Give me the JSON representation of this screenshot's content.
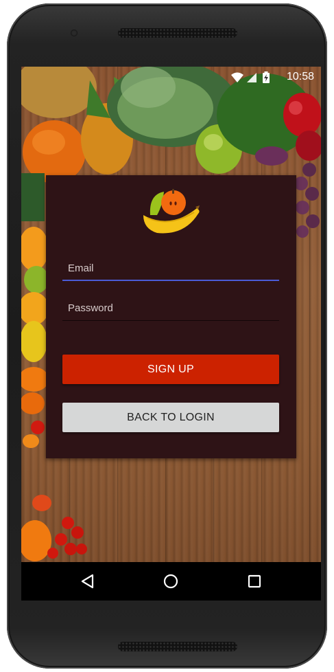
{
  "status_bar": {
    "time": "10:58",
    "icons": [
      "wifi-icon",
      "signal-icon",
      "battery-charging-icon"
    ]
  },
  "app": {
    "logo": "fruit-bowl-logo",
    "email": {
      "placeholder": "Email",
      "value": ""
    },
    "password": {
      "placeholder": "Password",
      "value": ""
    },
    "signup_label": "SIGN UP",
    "back_label": "BACK TO LOGIN"
  },
  "nav_bar": {
    "items": [
      "back-triangle-icon",
      "home-circle-icon",
      "recents-square-icon"
    ]
  },
  "colors": {
    "card_bg": "#2e1316",
    "accent": "#4a5bd6",
    "signup_bg": "#cc2200",
    "back_bg": "#d6d7d7"
  }
}
